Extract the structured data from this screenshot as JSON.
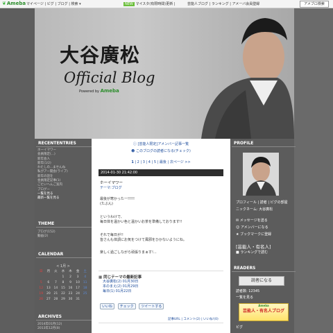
{
  "topbar": {
    "logo": "Ameba",
    "nav": "マイページ | ピグ | ブログ | 検索 ▾",
    "mid_badge": "NEW",
    "mid_text": "マイスタ(有限時間)更新 |",
    "right_text": "芸能人ブログ | ランキング | アメーバ会員登録",
    "search_button": "アメブロ検索"
  },
  "header": {
    "name": "大谷廣松",
    "official": "Official Blog",
    "powered_by": "Powered by",
    "powered_brand": "Ameba"
  },
  "left": {
    "recent_title": "RECENTENTRIES",
    "recent_entries": [
      "ホーイマワー",
      "会員限定(...)",
      "新年会人",
      "新年(1/2)",
      "わたしの...ませんね",
      "私がアー開会(ライブ)",
      "新年の話を",
      "会員限定記事(1)",
      "ごたいへんご案内",
      "ブログー"
    ],
    "recent_more": "一覧を見る",
    "recent_more2": "最新一覧を見る",
    "theme_title": "THEME",
    "themes": [
      "ブログ(152)",
      "動画(2)"
    ],
    "calendar_title": "CALENDAR",
    "cal_month": "< 1月 >",
    "cal_weekdays": [
      "日",
      "月",
      "火",
      "水",
      "木",
      "金",
      "土"
    ],
    "cal_rows": [
      [
        "",
        "",
        "",
        "1",
        "2",
        "3",
        "4"
      ],
      [
        "5",
        "6",
        "7",
        "8",
        "9",
        "10",
        "11"
      ],
      [
        "12",
        "13",
        "14",
        "15",
        "16",
        "17",
        "18"
      ],
      [
        "19",
        "20",
        "21",
        "22",
        "23",
        "24",
        "25"
      ],
      [
        "26",
        "27",
        "28",
        "29",
        "30",
        "31",
        ""
      ]
    ],
    "archives_title": "ARCHIVES",
    "archives": [
      "2014年01月(12)",
      "2013年12月(8)"
    ]
  },
  "main": {
    "notice1": "[芸能人限定]アメンバー記事一覧",
    "notice2": "このブログの読者になる(チェック)",
    "pager_pages": [
      "1",
      "2",
      "3",
      "4",
      "5"
    ],
    "pager_last": "最後",
    "pager_next": "次ページ >>",
    "date": "2014-01-30 21:42:00",
    "title": "ホーイマワー",
    "theme_label": "テーマ:ブログ",
    "lines": [
      "最後が寒かったー!!!!!",
      "(たぶん)",
      "",
      "というわけで、",
      "毎日体を温かい色と温かいお茶を準備しております!!",
      "",
      "それで毎日が!!",
      "皆さんも体調にお気をつけて風邪をひかないようにね。",
      "",
      "楽しく過ごしながら頑張りまぁす!..."
    ],
    "related_title": "同じテーマの最新記事",
    "related": [
      "大谷廣松(2)  01月30日",
      "本のまえ(2)  01月29日",
      "毎日(1)  01月22日"
    ],
    "share_buttons": [
      "いいね",
      "チェック",
      "ツイートする"
    ],
    "foot": "記事URL | コメント(2) | いいね!(0)"
  },
  "right": {
    "profile_title": "PROFILE",
    "profile_links": "プロフィール | 読者 | ピグの部屋",
    "profile_sub": "ニックネーム: 大谷廣松",
    "links": [
      "メッセージを送る",
      "アメンバーになる",
      "ブックマークに登録"
    ],
    "ranking": "[芸能人・有名人]",
    "ranking2": "■ ランキングで読む",
    "readers_title": "READERS",
    "readers_button": "読者になる",
    "readers_count": "読者数: 12345",
    "readers_more": "一覧を見る",
    "banner_top": "Ameba",
    "banner_text": "芸能人・有名人ブログ",
    "ads_label": "ピグ"
  }
}
